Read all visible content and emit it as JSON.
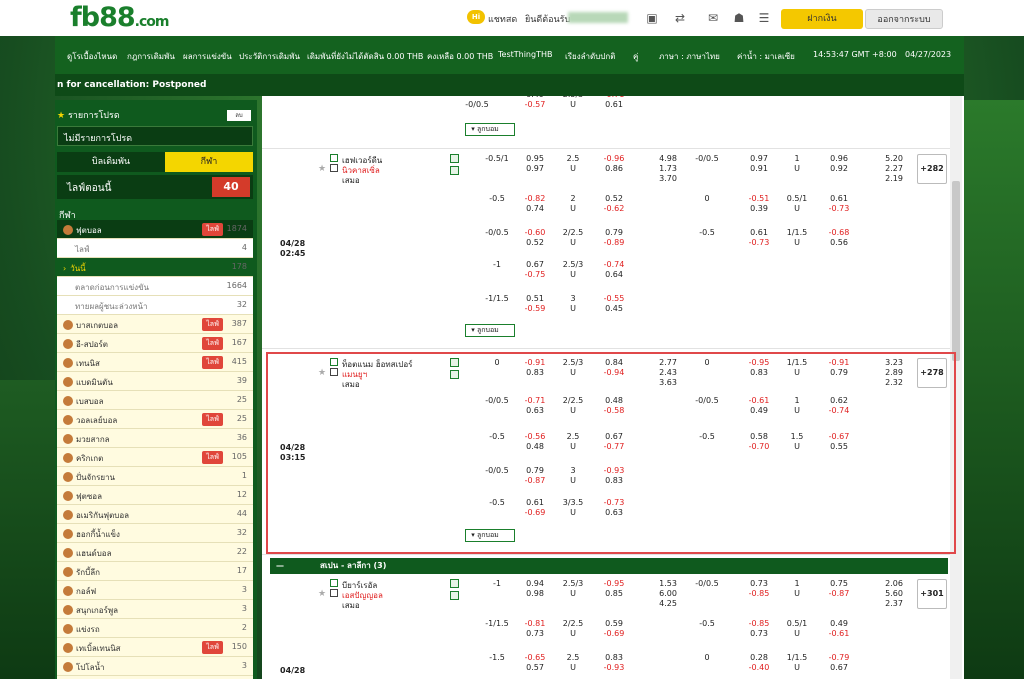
{
  "header": {
    "logo_main": "fb88",
    "logo_dot": ".com",
    "chat_badge": "Hi",
    "chat_label": "แชทสด",
    "welcome": "ยินดีต้อนรับ",
    "deposit_label": "ฝากเงิน",
    "logout_label": "ออกจากระบบ"
  },
  "nav": {
    "items": [
      "ดูโรเบื้องไหนด",
      "กฎการเดิมพัน",
      "ผลการแข่งขัน",
      "ประวัติการเดิมพัน",
      "เดิมพันที่ยังไม่ได้ตัดสิน 0.00 THB",
      "คงเหลือ 0.00 THB",
      "TestThingTHB"
    ],
    "sort": "เรียงลำดับปกติ",
    "pair": "คู่",
    "language": "ภาษา : ภาษาไทย",
    "odds": "ค่าน้ำ : มาเลเซีย",
    "time": "14:53:47 GMT +8:00",
    "date": "04/27/2023"
  },
  "subbar": "n for cancellation: Postponed",
  "sidebar": {
    "favorites": "รายการโปรด",
    "edit_btn": "ลบ",
    "no_favorites": "ไม่มีรายการโปรด",
    "tab_bets": "บิลเดิมพัน",
    "tab_sports": "กีฬา",
    "live_now": "ไลฟ์ตอนนี้",
    "live_count": "40",
    "sports_title": "กีฬา",
    "live_tag": "ไลฟ์",
    "rows": [
      {
        "label": "ฟุตบอล",
        "count": "1874",
        "live": true,
        "kind": "dark"
      },
      {
        "label": "ไลฟ์",
        "count": "4",
        "live": false,
        "kind": "sub"
      },
      {
        "label": "วันนี้",
        "count": "178",
        "live": false,
        "kind": "sel"
      },
      {
        "label": "ตลาดก่อนการแข่งขัน",
        "count": "1664",
        "live": false,
        "kind": "sub"
      },
      {
        "label": "ทายผลผู้ชนะล่วงหน้า",
        "count": "32",
        "live": false,
        "kind": "sub"
      },
      {
        "label": "บาสเกตบอล",
        "count": "387",
        "live": true,
        "kind": "sport"
      },
      {
        "label": "อี-สปอร์ต",
        "count": "167",
        "live": true,
        "kind": "sport"
      },
      {
        "label": "เทนนิส",
        "count": "415",
        "live": true,
        "kind": "sport"
      },
      {
        "label": "แบดมินตัน",
        "count": "39",
        "live": false,
        "kind": "sport"
      },
      {
        "label": "เบสบอล",
        "count": "25",
        "live": false,
        "kind": "sport"
      },
      {
        "label": "วอลเลย์บอล",
        "count": "25",
        "live": true,
        "kind": "sport"
      },
      {
        "label": "มวยสากล",
        "count": "36",
        "live": false,
        "kind": "sport"
      },
      {
        "label": "คริกเกต",
        "count": "105",
        "live": true,
        "kind": "sport"
      },
      {
        "label": "ปั่นจักรยาน",
        "count": "1",
        "live": false,
        "kind": "sport"
      },
      {
        "label": "ฟุตซอล",
        "count": "12",
        "live": false,
        "kind": "sport"
      },
      {
        "label": "อเมริกันฟุตบอล",
        "count": "44",
        "live": false,
        "kind": "sport"
      },
      {
        "label": "ฮอกกี้น้ำแข็ง",
        "count": "32",
        "live": false,
        "kind": "sport"
      },
      {
        "label": "แฮนด์บอล",
        "count": "22",
        "live": false,
        "kind": "sport"
      },
      {
        "label": "รักบี้ลีก",
        "count": "17",
        "live": false,
        "kind": "sport"
      },
      {
        "label": "กอล์ฟ",
        "count": "3",
        "live": false,
        "kind": "sport"
      },
      {
        "label": "สนุกเกอร์พูล",
        "count": "3",
        "live": false,
        "kind": "sport"
      },
      {
        "label": "แข่งรถ",
        "count": "2",
        "live": false,
        "kind": "sport"
      },
      {
        "label": "เทเบิ้ลเทนนิส",
        "count": "150",
        "live": true,
        "kind": "sport"
      },
      {
        "label": "โปโลน้ำ",
        "count": "3",
        "live": false,
        "kind": "sport"
      },
      {
        "label": "รักบี้ยูเนี่ยน",
        "count": "4",
        "live": false,
        "kind": "sport"
      }
    ]
  },
  "main": {
    "more_label": "ลูกบอม",
    "top_partial": [
      {
        "hdp": "-0/0.5",
        "o1": "0.49",
        "o1c": "blk",
        "o2": "-0.57",
        "o2c": "red",
        "ou": "2.5/3",
        "u": "U",
        "ov": "-0.71",
        "ovc": "red",
        "un": "0.61",
        "unc": "blk"
      }
    ],
    "match1": {
      "date": "04/28",
      "time": "02:45",
      "home": "เฮฟเวอร์ดีน",
      "away": "นิวคาสเซิ่ล",
      "draw": "เสมอ",
      "plus": "+282"
    },
    "match1_rows": [
      [
        "-0.5/1",
        "0.95",
        "blk",
        "0.97",
        "blk",
        "2.5",
        "U",
        "-0.96",
        "red",
        "0.86",
        "blk",
        "4.98",
        "1.73",
        "3.70",
        "-0/0.5",
        "0.97",
        "blk",
        "0.91",
        "blk",
        "1",
        "U",
        "0.96",
        "blk",
        "0.92",
        "blk",
        "5.20",
        "2.27",
        "2.19"
      ],
      [
        "-0.5",
        "-0.82",
        "red",
        "0.74",
        "blk",
        "2",
        "U",
        "0.52",
        "blk",
        "-0.62",
        "red",
        "",
        "",
        "",
        "0",
        "-0.51",
        "red",
        "0.39",
        "blk",
        "0.5/1",
        "U",
        "0.61",
        "blk",
        "-0.73",
        "red",
        "",
        "",
        ""
      ],
      [
        "-0/0.5",
        "-0.60",
        "red",
        "0.52",
        "blk",
        "2/2.5",
        "U",
        "0.79",
        "blk",
        "-0.89",
        "red",
        "",
        "",
        "",
        "-0.5",
        "0.61",
        "blk",
        "-0.73",
        "red",
        "1/1.5",
        "U",
        "-0.68",
        "red",
        "0.56",
        "blk",
        "",
        "",
        ""
      ],
      [
        "-1",
        "0.67",
        "blk",
        "-0.75",
        "red",
        "2.5/3",
        "U",
        "-0.74",
        "red",
        "0.64",
        "blk",
        "",
        "",
        "",
        "",
        "",
        "",
        "",
        "",
        "",
        "",
        "",
        "",
        "",
        "",
        "",
        "",
        ""
      ],
      [
        "-1/1.5",
        "0.51",
        "blk",
        "-0.59",
        "red",
        "3",
        "U",
        "-0.55",
        "red",
        "0.45",
        "blk",
        "",
        "",
        "",
        "",
        "",
        "",
        "",
        "",
        "",
        "",
        "",
        "",
        "",
        "",
        "",
        "",
        ""
      ]
    ],
    "match2": {
      "date": "04/28",
      "time": "03:15",
      "home": "ท็อตแนม ฮ็อทสเปอร์",
      "away": "แมนยูฯ",
      "draw": "เสมอ",
      "plus": "+278"
    },
    "match2_rows": [
      [
        "0",
        "-0.91",
        "red",
        "0.83",
        "blk",
        "2.5/3",
        "U",
        "0.84",
        "blk",
        "-0.94",
        "red",
        "2.77",
        "2.43",
        "3.63",
        "0",
        "-0.95",
        "red",
        "0.83",
        "blk",
        "1/1.5",
        "U",
        "-0.91",
        "red",
        "0.79",
        "blk",
        "3.23",
        "2.89",
        "2.32"
      ],
      [
        "-0/0.5",
        "-0.71",
        "red",
        "0.63",
        "blk",
        "2/2.5",
        "U",
        "0.48",
        "blk",
        "-0.58",
        "red",
        "",
        "",
        "",
        "-0/0.5",
        "-0.61",
        "red",
        "0.49",
        "blk",
        "1",
        "U",
        "0.62",
        "blk",
        "-0.74",
        "red",
        "",
        "",
        ""
      ],
      [
        "-0.5",
        "-0.56",
        "red",
        "0.48",
        "blk",
        "2.5",
        "U",
        "0.67",
        "blk",
        "-0.77",
        "red",
        "",
        "",
        "",
        "-0.5",
        "0.58",
        "blk",
        "-0.70",
        "red",
        "1.5",
        "U",
        "-0.67",
        "red",
        "0.55",
        "blk",
        "",
        "",
        ""
      ],
      [
        "-0/0.5",
        "0.79",
        "blk",
        "-0.87",
        "red",
        "3",
        "U",
        "-0.93",
        "red",
        "0.83",
        "blk",
        "",
        "",
        "",
        "",
        "",
        "",
        "",
        "",
        "",
        "",
        "",
        "",
        "",
        "",
        "",
        "",
        ""
      ],
      [
        "-0.5",
        "0.61",
        "blk",
        "-0.69",
        "red",
        "3/3.5",
        "U",
        "-0.73",
        "red",
        "0.63",
        "blk",
        "",
        "",
        "",
        "",
        "",
        "",
        "",
        "",
        "",
        "",
        "",
        "",
        "",
        "",
        "",
        "",
        ""
      ]
    ],
    "league": "สเปน - ลาลีกา (3)",
    "league_minus": "—",
    "match3": {
      "date": "04/28",
      "time": "",
      "home": "บียาร์เรอัล",
      "away": "เอสปัญญอล",
      "draw": "เสมอ",
      "plus": "+301"
    },
    "match3_rows": [
      [
        "-1",
        "0.94",
        "blk",
        "0.98",
        "blk",
        "2.5/3",
        "U",
        "-0.95",
        "red",
        "0.85",
        "blk",
        "1.53",
        "6.00",
        "4.25",
        "-0/0.5",
        "0.73",
        "blk",
        "-0.85",
        "red",
        "1",
        "U",
        "0.75",
        "blk",
        "-0.87",
        "red",
        "2.06",
        "5.60",
        "2.37"
      ],
      [
        "-1/1.5",
        "-0.81",
        "red",
        "0.73",
        "blk",
        "2/2.5",
        "U",
        "0.59",
        "blk",
        "-0.69",
        "red",
        "",
        "",
        "",
        "-0.5",
        "-0.85",
        "red",
        "0.73",
        "blk",
        "0.5/1",
        "U",
        "0.49",
        "blk",
        "-0.61",
        "red",
        "",
        "",
        ""
      ],
      [
        "-1.5",
        "-0.65",
        "red",
        "0.57",
        "blk",
        "2.5",
        "U",
        "0.83",
        "blk",
        "-0.93",
        "red",
        "",
        "",
        "",
        "0",
        "0.28",
        "blk",
        "-0.40",
        "red",
        "1/1.5",
        "U",
        "-0.79",
        "red",
        "0.67",
        "blk",
        "",
        "",
        ""
      ]
    ]
  },
  "colors": {
    "brand_green": "#1a7f2c",
    "accent_yellow": "#f4d600",
    "live_red": "#e0463a",
    "odds_red": "#e02020",
    "highlight": "#e0484a"
  }
}
